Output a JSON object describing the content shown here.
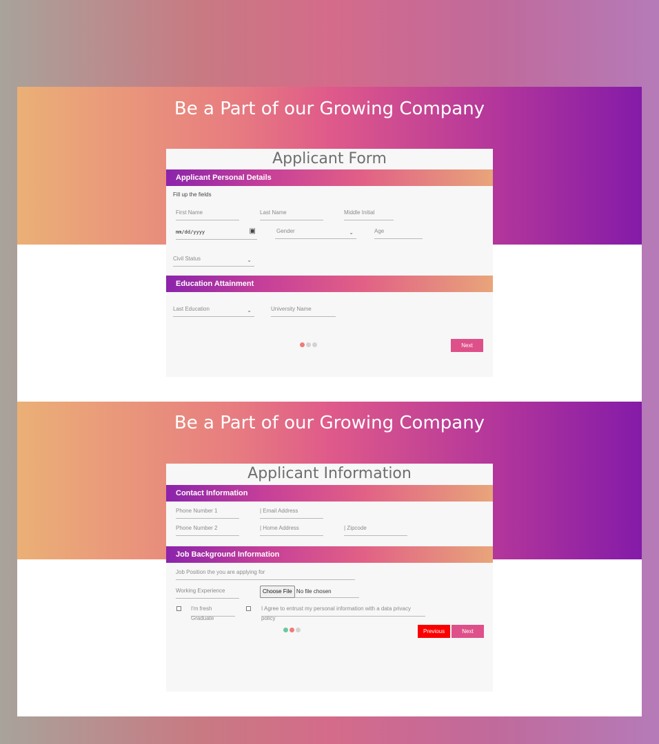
{
  "hero_title": "Be a Part of our Growing Company",
  "form1": {
    "title": "Applicant Form",
    "section_personal": "Applicant Personal Details",
    "hint": "Fill up the fields",
    "first_name": "First Name",
    "last_name": "Last Name",
    "middle_initial": "Middle Initial",
    "date_placeholder": "mm/dd/yyyy",
    "gender": "Gender",
    "age": "Age",
    "civil_status": "Civil Status",
    "section_education": "Education Attainment",
    "last_education": "Last Education",
    "university_name": "University Name",
    "next_label": "Next",
    "step": {
      "current": 1,
      "total": 3
    }
  },
  "form2": {
    "title": "Applicant Information",
    "section_contact": "Contact Information",
    "phone1": "Phone Number 1",
    "email": "| Email Address",
    "phone2": "Phone Number 2",
    "home_address": "| Home Address",
    "zipcode": "| Zipcode",
    "section_job": "Job Background Information",
    "job_position": "Job Position the you are applying for",
    "working_experience": "Working Experience",
    "choose_file": "Choose File",
    "no_file": "No file chosen",
    "fresh_graduate": "I'm fresh Graduate",
    "privacy_agree": "I Agree to entrust my personal information with a data privacy policy",
    "previous_label": "Previous",
    "next_label": "Next",
    "step": {
      "current": 2,
      "total": 3
    }
  },
  "colors": {
    "next_button": "#de5089",
    "previous_button": "#fb0000",
    "dot_active": "#f07b76",
    "dot_done": "#68c9a0"
  }
}
